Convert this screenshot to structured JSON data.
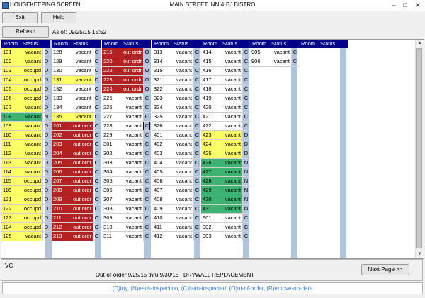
{
  "window": {
    "title": "HOUSEKEEPING SCREEN",
    "center_title": "MAIN STREET INN & BJ BISTRO"
  },
  "toolbar": {
    "exit_label": "Exit",
    "help_label": "Help",
    "refresh_label": "Refresh",
    "as_of": "As of: 09/25/15  15:52"
  },
  "grid": {
    "header": {
      "room": "Room",
      "status": "Status"
    },
    "columns": [
      [
        [
          "101",
          "vacant",
          "D",
          "yellow"
        ],
        [
          "102",
          "vacant",
          "D",
          "yellow"
        ],
        [
          "103",
          "occupd",
          "D",
          "yellow"
        ],
        [
          "104",
          "occupd",
          "D",
          "yellow"
        ],
        [
          "105",
          "occupd",
          "D",
          "yellow"
        ],
        [
          "106",
          "occupd",
          "D",
          "yellow"
        ],
        [
          "107",
          "vacant",
          "D",
          "yellow"
        ],
        [
          "108",
          "vacant",
          "N",
          "green"
        ],
        [
          "109",
          "vacant",
          "D",
          "yellow"
        ],
        [
          "110",
          "vacant",
          "D",
          "yellow"
        ],
        [
          "111",
          "vacant",
          "D",
          "yellow"
        ],
        [
          "112",
          "vacant",
          "D",
          "yellow"
        ],
        [
          "113",
          "vacant",
          "D",
          "yellow"
        ],
        [
          "114",
          "vacant",
          "D",
          "yellow"
        ],
        [
          "115",
          "occupd",
          "D",
          "yellow"
        ],
        [
          "116",
          "occupd",
          "D",
          "yellow"
        ],
        [
          "121",
          "occupd",
          "D",
          "yellow"
        ],
        [
          "122",
          "occupd",
          "D",
          "yellow"
        ],
        [
          "123",
          "occupd",
          "D",
          "yellow"
        ],
        [
          "124",
          "occupd",
          "D",
          "yellow"
        ],
        [
          "125",
          "vacant",
          "D",
          "yellow"
        ]
      ],
      [
        [
          "128",
          "vacant",
          "C",
          "white"
        ],
        [
          "129",
          "vacant",
          "C",
          "white"
        ],
        [
          "130",
          "vacant",
          "C",
          "white"
        ],
        [
          "131",
          "vacant",
          "D",
          "yellow"
        ],
        [
          "132",
          "vacant",
          "C",
          "white"
        ],
        [
          "133",
          "vacant",
          "C",
          "white"
        ],
        [
          "134",
          "vacant",
          "C",
          "white"
        ],
        [
          "135",
          "vacant",
          "D",
          "yellow"
        ],
        [
          "201",
          "out ordr",
          "O",
          "red"
        ],
        [
          "202",
          "out ordr",
          "O",
          "red"
        ],
        [
          "203",
          "out ordr",
          "O",
          "red"
        ],
        [
          "204",
          "out ordr",
          "O",
          "red"
        ],
        [
          "205",
          "out ordr",
          "O",
          "red"
        ],
        [
          "206",
          "out ordr",
          "O",
          "red"
        ],
        [
          "207",
          "out ordr",
          "O",
          "red"
        ],
        [
          "208",
          "out ordr",
          "O",
          "red"
        ],
        [
          "209",
          "out ordr",
          "O",
          "red"
        ],
        [
          "210",
          "out ordr",
          "O",
          "red"
        ],
        [
          "211",
          "out ordr",
          "O",
          "red"
        ],
        [
          "212",
          "out ordr",
          "O",
          "red"
        ],
        [
          "213",
          "out ordr",
          "O",
          "red"
        ]
      ],
      [
        [
          "215",
          "out ordr",
          "O",
          "red"
        ],
        [
          "220",
          "out ordr",
          "O",
          "red"
        ],
        [
          "222",
          "out ordr",
          "O",
          "red"
        ],
        [
          "223",
          "out ordr",
          "O",
          "red"
        ],
        [
          "224",
          "out ordr",
          "O",
          "red"
        ],
        [
          "225",
          "vacant",
          "C",
          "white"
        ],
        [
          "226",
          "vacant",
          "C",
          "white"
        ],
        [
          "227",
          "vacant",
          "C",
          "white"
        ],
        [
          "228",
          "vacant",
          "C",
          "white"
        ],
        [
          "229",
          "vacant",
          "C",
          "white"
        ],
        [
          "301",
          "vacant",
          "C",
          "white"
        ],
        [
          "302",
          "vacant",
          "C",
          "white"
        ],
        [
          "303",
          "vacant",
          "C",
          "white"
        ],
        [
          "304",
          "vacant",
          "C",
          "white"
        ],
        [
          "305",
          "vacant",
          "C",
          "white"
        ],
        [
          "306",
          "vacant",
          "C",
          "white"
        ],
        [
          "307",
          "vacant",
          "C",
          "white"
        ],
        [
          "308",
          "vacant",
          "C",
          "white"
        ],
        [
          "309",
          "vacant",
          "C",
          "white"
        ],
        [
          "310",
          "vacant",
          "C",
          "white"
        ],
        [
          "311",
          "vacant",
          "C",
          "white"
        ]
      ],
      [
        [
          "313",
          "vacant",
          "C",
          "white"
        ],
        [
          "314",
          "vacant",
          "C",
          "white"
        ],
        [
          "315",
          "vacant",
          "C",
          "white"
        ],
        [
          "321",
          "vacant",
          "C",
          "white"
        ],
        [
          "322",
          "vacant",
          "C",
          "white"
        ],
        [
          "323",
          "vacant",
          "C",
          "white"
        ],
        [
          "324",
          "vacant",
          "C",
          "white"
        ],
        [
          "325",
          "vacant",
          "C",
          "white"
        ],
        [
          "326",
          "vacant",
          "C",
          "white"
        ],
        [
          "401",
          "vacant",
          "C",
          "white"
        ],
        [
          "402",
          "vacant",
          "C",
          "white"
        ],
        [
          "403",
          "vacant",
          "C",
          "white"
        ],
        [
          "404",
          "vacant",
          "C",
          "white"
        ],
        [
          "405",
          "vacant",
          "C",
          "white"
        ],
        [
          "406",
          "vacant",
          "C",
          "white"
        ],
        [
          "407",
          "vacant",
          "C",
          "white"
        ],
        [
          "408",
          "vacant",
          "C",
          "white"
        ],
        [
          "409",
          "vacant",
          "C",
          "white"
        ],
        [
          "410",
          "vacant",
          "C",
          "white"
        ],
        [
          "411",
          "vacant",
          "C",
          "white"
        ],
        [
          "412",
          "vacant",
          "C",
          "white"
        ]
      ],
      [
        [
          "414",
          "vacant",
          "C",
          "white"
        ],
        [
          "415",
          "vacant",
          "C",
          "white"
        ],
        [
          "416",
          "vacant",
          "C",
          "white"
        ],
        [
          "417",
          "vacant",
          "C",
          "white"
        ],
        [
          "418",
          "vacant",
          "C",
          "white"
        ],
        [
          "419",
          "vacant",
          "C",
          "white"
        ],
        [
          "420",
          "vacant",
          "C",
          "white"
        ],
        [
          "421",
          "vacant",
          "C",
          "white"
        ],
        [
          "422",
          "vacant",
          "C",
          "white"
        ],
        [
          "423",
          "vacant",
          "D",
          "yellow"
        ],
        [
          "424",
          "vacant",
          "D",
          "yellow"
        ],
        [
          "425",
          "vacant",
          "D",
          "yellow"
        ],
        [
          "426",
          "vacant",
          "N",
          "green"
        ],
        [
          "427",
          "vacant",
          "N",
          "green"
        ],
        [
          "428",
          "vacant",
          "N",
          "green"
        ],
        [
          "429",
          "vacant",
          "N",
          "green"
        ],
        [
          "430",
          "vacant",
          "N",
          "green"
        ],
        [
          "431",
          "vacant",
          "N",
          "green"
        ],
        [
          "901",
          "vacant",
          "C",
          "white"
        ],
        [
          "902",
          "vacant",
          "C",
          "white"
        ],
        [
          "903",
          "vacant",
          "C",
          "white"
        ]
      ],
      [
        [
          "905",
          "vacant",
          "C",
          "white"
        ],
        [
          "906",
          "vacant",
          "C",
          "white"
        ]
      ],
      []
    ]
  },
  "bottom": {
    "vc": "VC",
    "out_of_order": "Out-of-order  9/25/15 thru  9/30/15 : DRYWALL REPLACEMENT",
    "next_page_label": "Next Page >>"
  },
  "legend": "(D)irty, (N)eeds-inspection, (C)lean-inspected, (O)ut-of-order, (R)emove-oo-date",
  "colors": {
    "header": "#00008b",
    "dirty": "#ffff66",
    "out_of_order": "#b22222",
    "needs_inspection": "#3cb371",
    "stripe": "#b0c4de"
  }
}
